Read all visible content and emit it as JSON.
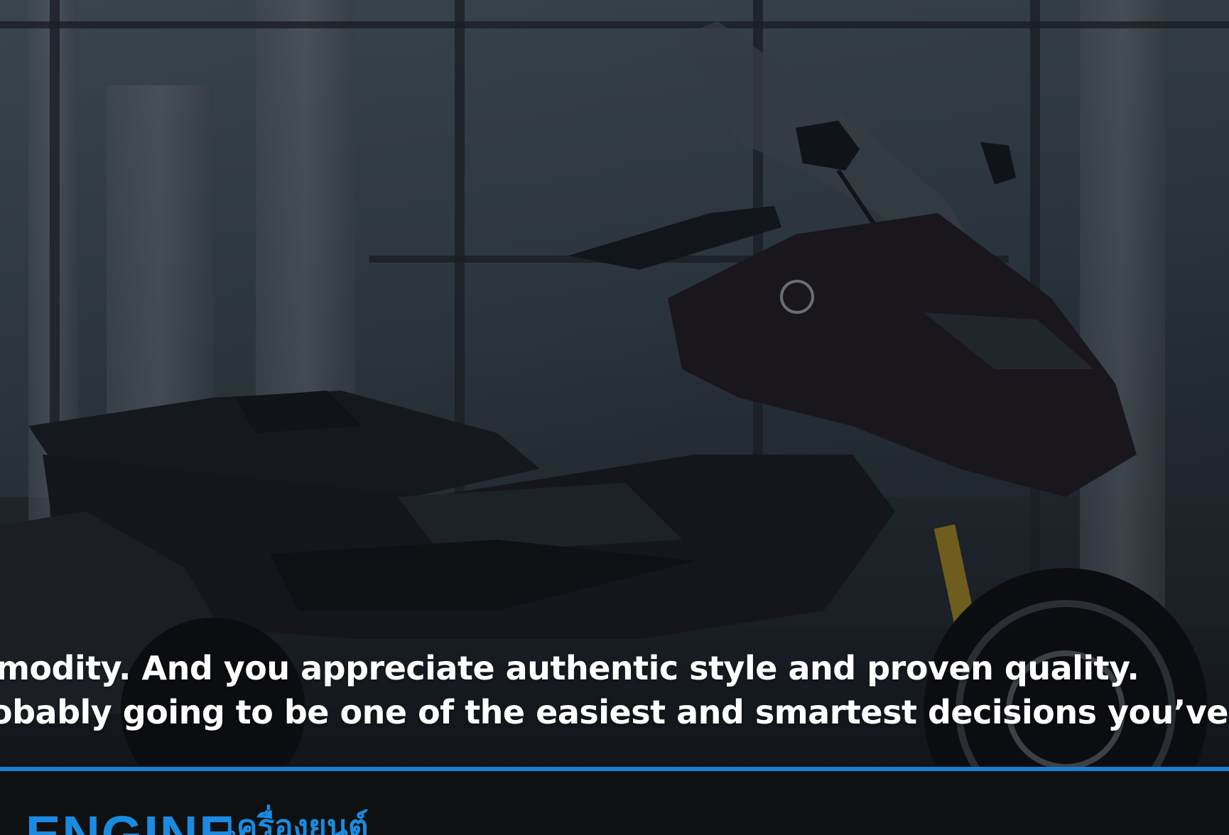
{
  "hero": {
    "line1": "modity. And you appreciate authentic style and proven quality.",
    "line2": "obably going to be one of the easiest and smartest decisions you’ve made fo"
  },
  "section": {
    "title": "ENGINE",
    "subtitle": "เครื่องยนต์"
  },
  "colors": {
    "accent": "#1a7fd4",
    "heading": "#1a8be0",
    "text": "#ffffff",
    "background": "#0f1012"
  },
  "images": {
    "hero": "motorcycle-scooter-photo"
  }
}
